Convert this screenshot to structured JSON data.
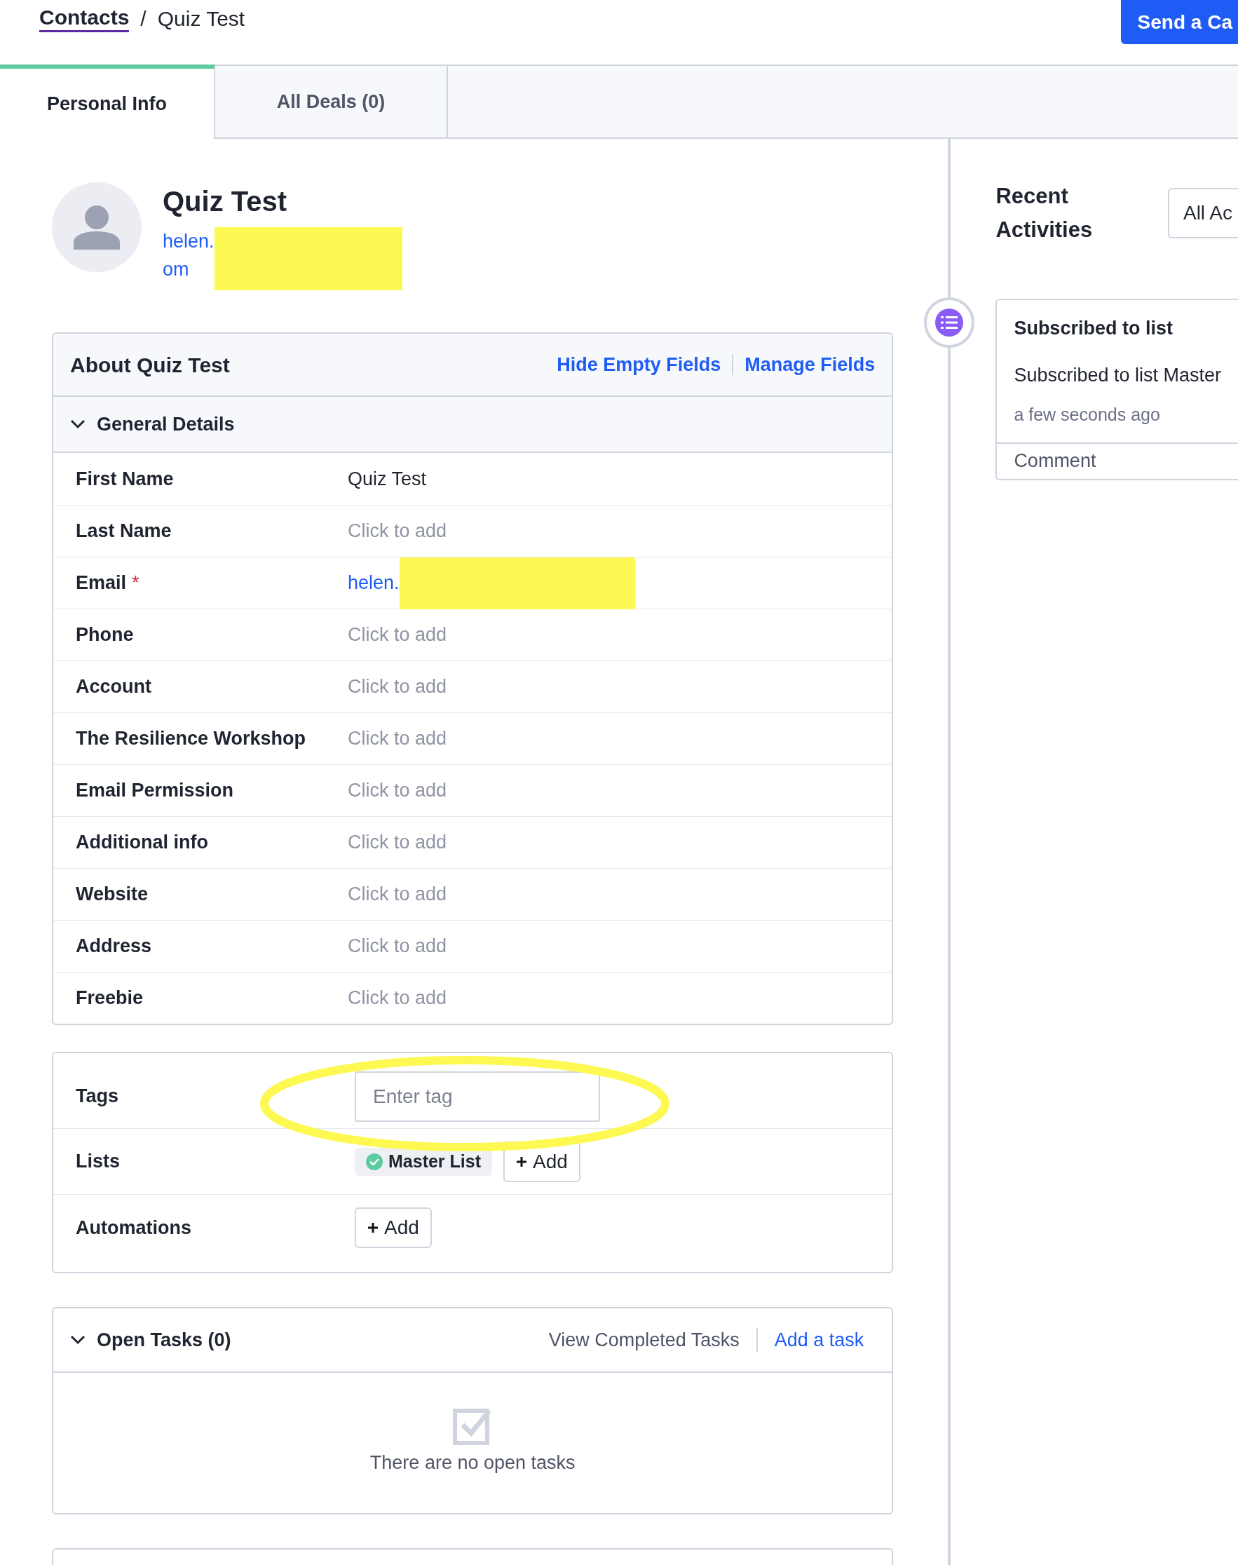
{
  "breadcrumb": {
    "parent": "Contacts",
    "separator": "/",
    "current": "Quiz Test"
  },
  "header_button": "Send a Ca",
  "tabs": [
    {
      "label": "Personal Info",
      "selected": true
    },
    {
      "label": "All Deals (0)",
      "selected": false
    }
  ],
  "contact": {
    "name": "Quiz Test",
    "email_lines": [
      "helen.",
      "om"
    ]
  },
  "about": {
    "title": "About Quiz Test",
    "actions": [
      "Hide Empty Fields",
      "Manage Fields"
    ],
    "section": {
      "title": "General Details",
      "expanded": true
    },
    "fields": [
      {
        "label": "First Name",
        "value": "Quiz Test",
        "kind": "text"
      },
      {
        "label": "Last Name",
        "placeholder": "Click to add",
        "kind": "empty"
      },
      {
        "label": "Email",
        "marker": "*",
        "value": "helen.",
        "kind": "link"
      },
      {
        "label": "Phone",
        "placeholder": "Click to add",
        "kind": "empty"
      },
      {
        "label": "Account",
        "placeholder": "Click to add",
        "kind": "empty"
      },
      {
        "label": "The Resilience Workshop",
        "placeholder": "Click to add",
        "kind": "empty"
      },
      {
        "label": "Email Permission",
        "placeholder": "Click to add",
        "kind": "empty"
      },
      {
        "label": "Additional info",
        "placeholder": "Click to add",
        "kind": "empty"
      },
      {
        "label": "Website",
        "placeholder": "Click to add",
        "kind": "empty"
      },
      {
        "label": "Address",
        "placeholder": "Click to add",
        "kind": "empty"
      },
      {
        "label": "Freebie",
        "placeholder": "Click to add",
        "kind": "empty"
      }
    ]
  },
  "tags": {
    "label": "Tags",
    "placeholder": "Enter tag"
  },
  "lists": {
    "label": "Lists",
    "items": [
      {
        "name": "Master List"
      }
    ],
    "add": "Add"
  },
  "automations": {
    "label": "Automations",
    "add": "Add"
  },
  "tasks": {
    "title": "Open Tasks (0)",
    "expanded": true,
    "actions": [
      "View Completed Tasks",
      "Add a task"
    ],
    "empty": "There are no open tasks"
  },
  "recent": {
    "title": "Recent Activities",
    "filter": "All Ac",
    "activities": [
      {
        "title": "Subscribed to list",
        "detail": "Subscribed to list Master",
        "time": "a few seconds ago",
        "comment": "Comment"
      }
    ]
  }
}
